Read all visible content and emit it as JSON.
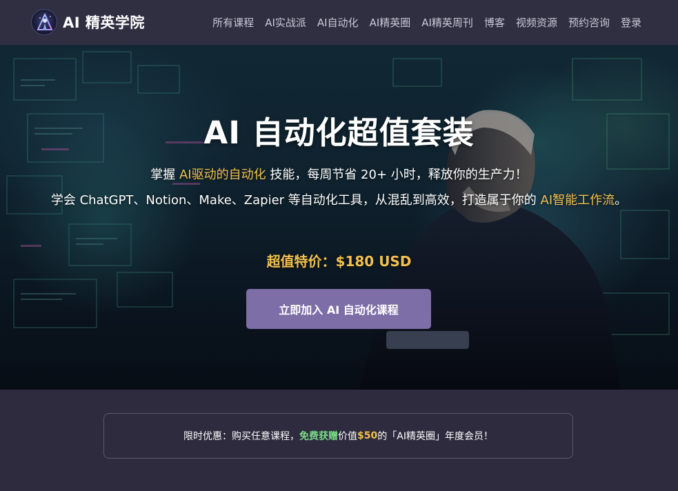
{
  "nav": {
    "brand": "AI 精英学院",
    "items": [
      {
        "label": "所有课程"
      },
      {
        "label": "AI实战派"
      },
      {
        "label": "AI自动化"
      },
      {
        "label": "AI精英圈"
      },
      {
        "label": "AI精英周刊"
      },
      {
        "label": "博客"
      },
      {
        "label": "视频资源"
      },
      {
        "label": "预约咨询"
      },
      {
        "label": "登录"
      }
    ]
  },
  "hero": {
    "title": "AI 自动化超值套装",
    "line1_a": "掌握 ",
    "line1_hl": "AI驱动的自动化",
    "line1_b": " 技能，每周节省 20+ 小时，释放你的生产力！",
    "line2_a": "学会 ChatGPT、Notion、Make、Zapier 等自动化工具，从混乱到高效，打造属于你的 ",
    "line2_hl": "AI智能工作流",
    "line2_b": "。",
    "price": "超值特价：$180 USD",
    "cta_label": "立即加入 AI 自动化课程"
  },
  "promo": {
    "text_a": "限时优惠：购买任意课程，",
    "text_green": "免费获赠",
    "text_b": " 价值 ",
    "text_gold": "$50",
    "text_c": " 的「AI精英圈」年度会员！"
  },
  "colors": {
    "page_bg": "#2d2b3d",
    "nav_bg": "#302e41",
    "accent_gold": "#f2c04d",
    "cta_bg": "#7e6ea8",
    "promo_green": "#7bdc8a"
  },
  "icons": {
    "logo": "triangle-figure-logo-icon"
  }
}
